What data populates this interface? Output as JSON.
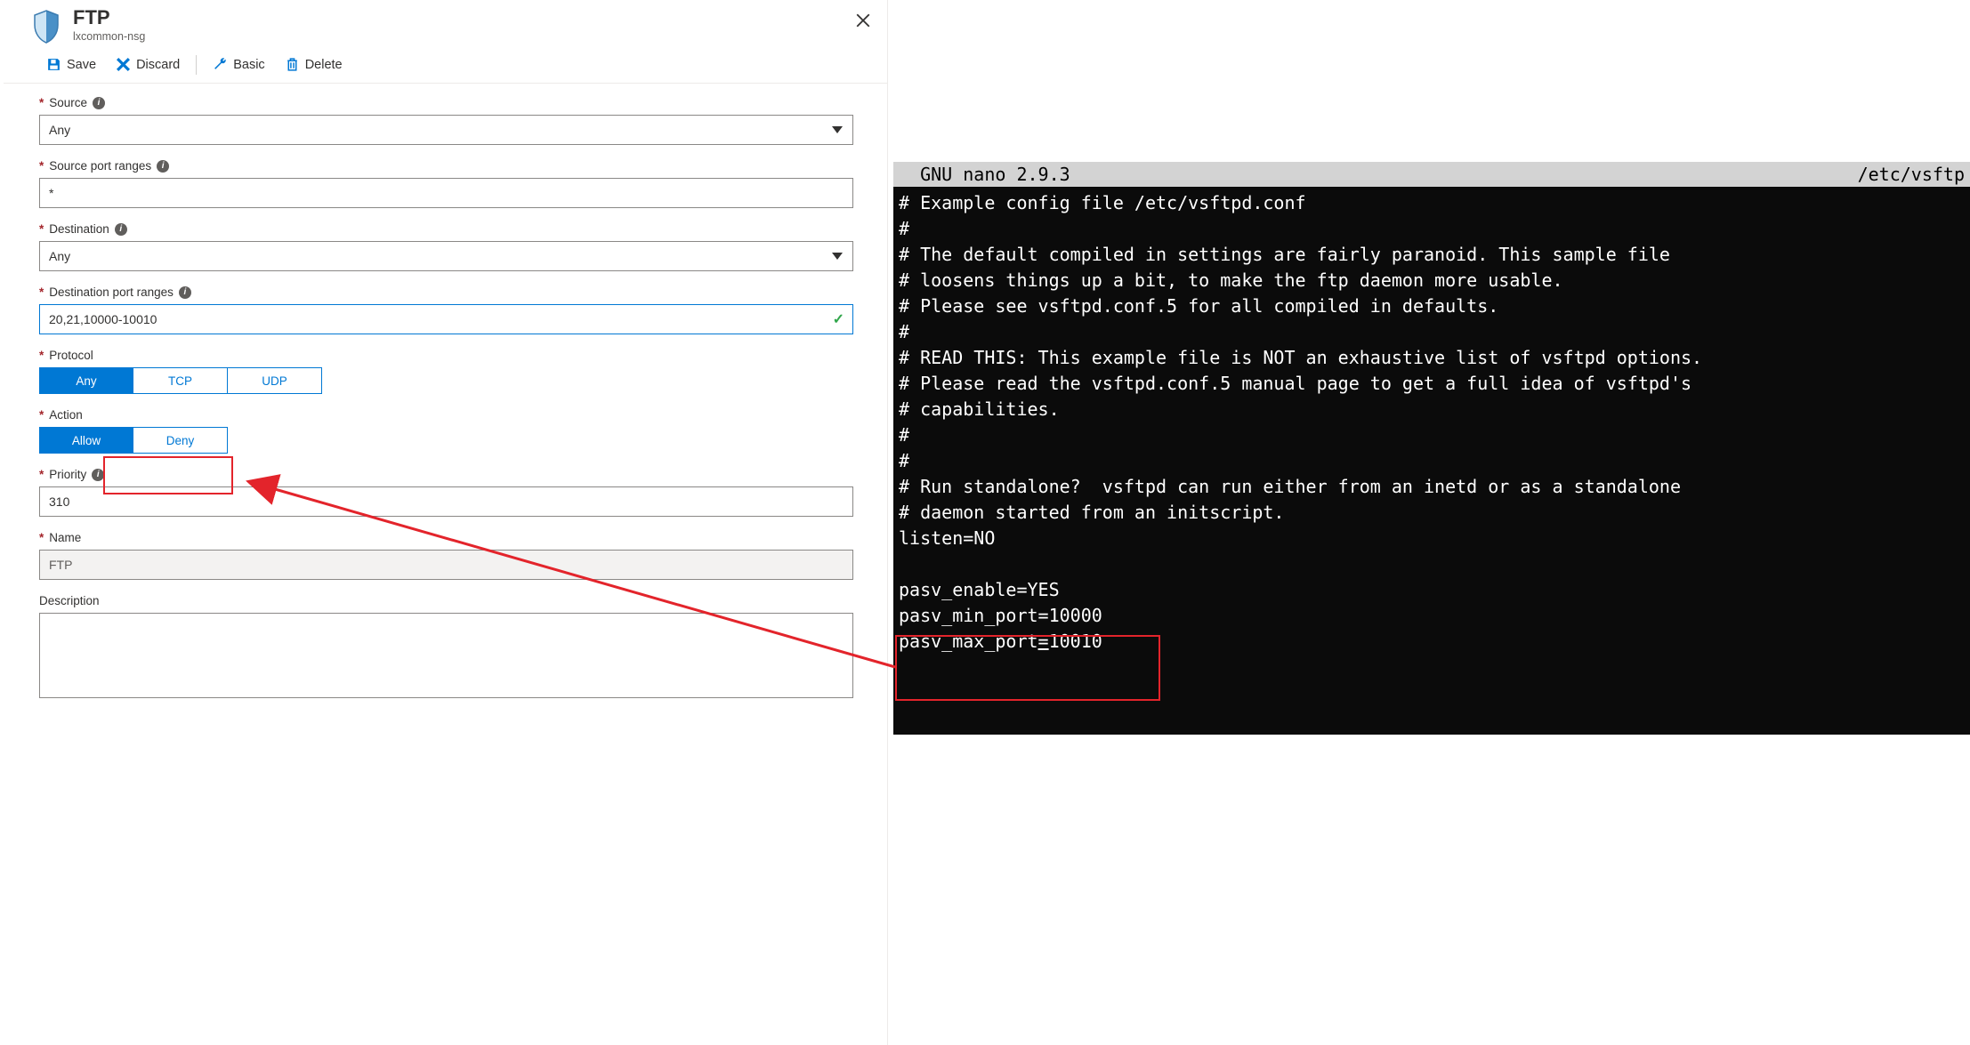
{
  "header": {
    "title": "FTP",
    "subtitle": "lxcommon-nsg"
  },
  "toolbar": {
    "save_label": "Save",
    "discard_label": "Discard",
    "basic_label": "Basic",
    "delete_label": "Delete"
  },
  "form": {
    "source": {
      "label": "Source",
      "value": "Any"
    },
    "source_port_ranges": {
      "label": "Source port ranges",
      "value": "*"
    },
    "destination": {
      "label": "Destination",
      "value": "Any"
    },
    "destination_port_ranges": {
      "label": "Destination port ranges",
      "value": "20,21,10000-10010"
    },
    "protocol": {
      "label": "Protocol",
      "options": [
        "Any",
        "TCP",
        "UDP"
      ],
      "selected": "Any"
    },
    "action": {
      "label": "Action",
      "options": [
        "Allow",
        "Deny"
      ],
      "selected": "Allow"
    },
    "priority": {
      "label": "Priority",
      "value": "310"
    },
    "name": {
      "label": "Name",
      "value": "FTP"
    },
    "description": {
      "label": "Description",
      "value": ""
    }
  },
  "terminal": {
    "title_left": "  GNU nano 2.9.3",
    "title_right": "/etc/vsftp",
    "lines": [
      "# Example config file /etc/vsftpd.conf",
      "#",
      "# The default compiled in settings are fairly paranoid. This sample file",
      "# loosens things up a bit, to make the ftp daemon more usable.",
      "# Please see vsftpd.conf.5 for all compiled in defaults.",
      "#",
      "# READ THIS: This example file is NOT an exhaustive list of vsftpd options.",
      "# Please read the vsftpd.conf.5 manual page to get a full idea of vsftpd's",
      "# capabilities.",
      "#",
      "#",
      "# Run standalone?  vsftpd can run either from an inetd or as a standalone",
      "# daemon started from an initscript.",
      "listen=NO",
      "",
      "pasv_enable=YES",
      "pasv_min_port=10000"
    ],
    "cursor_line_prefix": "pasv_max_port",
    "cursor_line_suffix": "10010",
    "cursor_char": "="
  }
}
